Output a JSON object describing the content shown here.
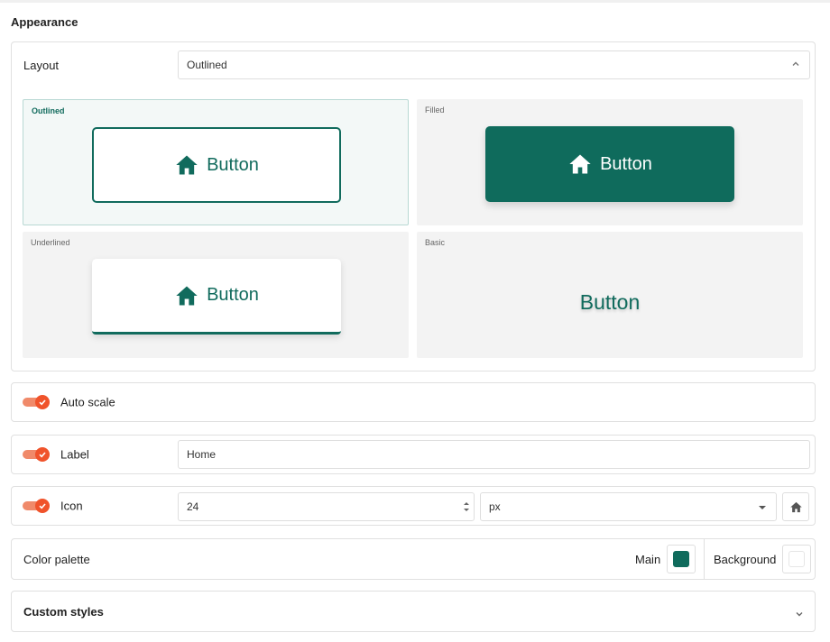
{
  "section": {
    "title": "Appearance"
  },
  "layout": {
    "label": "Layout",
    "selected": "Outlined",
    "options": [
      {
        "name": "Outlined",
        "button_label": "Button",
        "style": "outlined",
        "selected": true
      },
      {
        "name": "Filled",
        "button_label": "Button",
        "style": "filled",
        "selected": false
      },
      {
        "name": "Underlined",
        "button_label": "Button",
        "style": "underlined",
        "selected": false
      },
      {
        "name": "Basic",
        "button_label": "Button",
        "style": "basic",
        "selected": false
      }
    ]
  },
  "auto_scale": {
    "label": "Auto scale",
    "enabled": true
  },
  "label_row": {
    "label": "Label",
    "enabled": true,
    "value": "Home"
  },
  "icon_row": {
    "label": "Icon",
    "enabled": true,
    "size": "24",
    "unit": "px",
    "icon": "home-icon"
  },
  "color_palette": {
    "label": "Color palette",
    "main_label": "Main",
    "main_color": "#0f6b5c",
    "background_label": "Background",
    "background_color": "#ffffff"
  },
  "custom_styles": {
    "label": "Custom styles"
  },
  "colors": {
    "accent": "#116b5d",
    "toggle": "#f0532b"
  }
}
